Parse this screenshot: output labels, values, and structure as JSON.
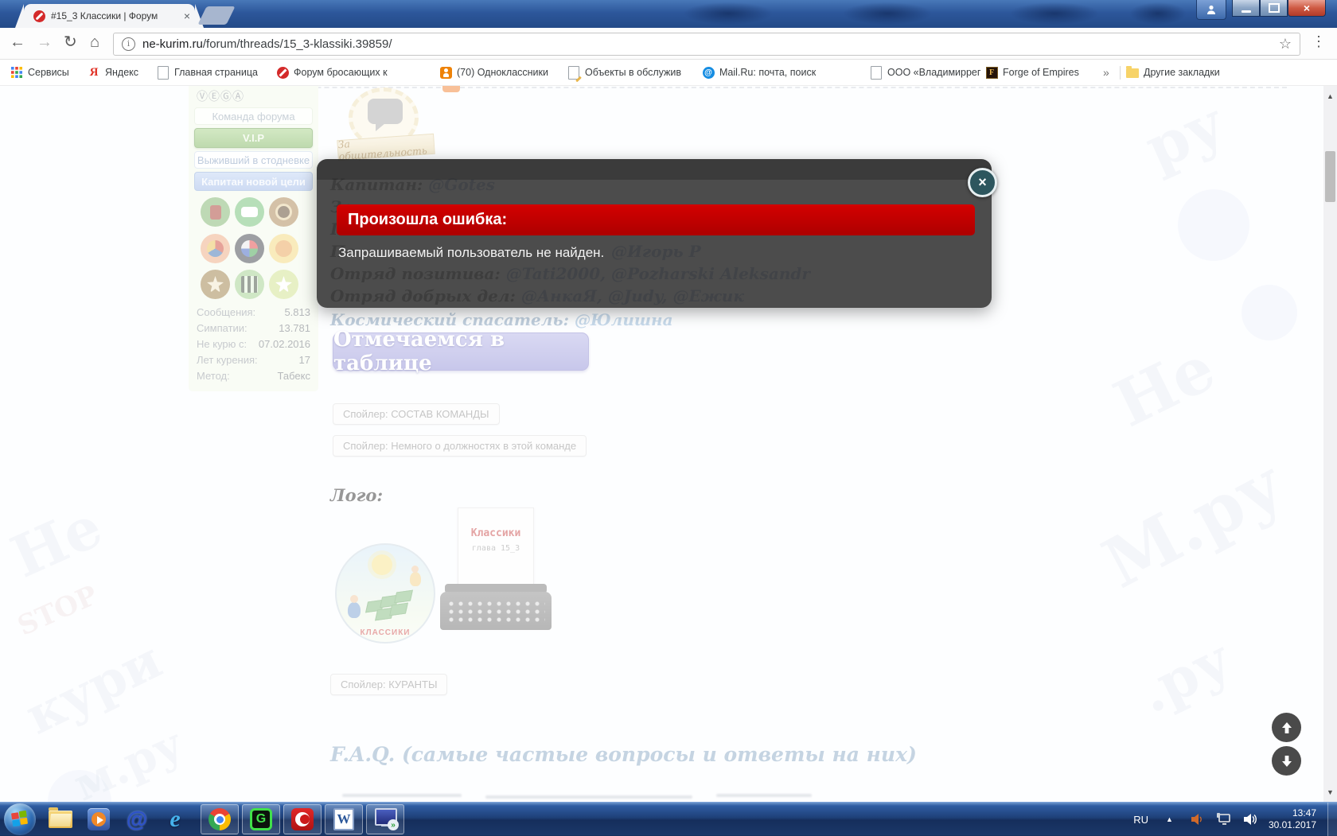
{
  "browser": {
    "tab_title": "#15_3 Классики | Форум",
    "url_host": "ne-kurim.ru",
    "url_path": "/forum/threads/15_3-klassiki.39859/",
    "overflow_chevron": "»",
    "other_bookmarks": "Другие закладки",
    "bookmarks": [
      {
        "label": "Сервисы"
      },
      {
        "label": "Яндекс"
      },
      {
        "label": "Главная страница"
      },
      {
        "label": "Форум бросающих к"
      },
      {
        "label": "(70) Одноклассники"
      },
      {
        "label": "Объекты в обслужив"
      },
      {
        "label": "Mail.Ru: почта, поиск"
      },
      {
        "label": "ООО «Владимиррег"
      },
      {
        "label": "Forge of Empires"
      }
    ]
  },
  "icons": {
    "yandex": "Я",
    "mail_at": "@",
    "forge_f": "F",
    "ie_e": "e",
    "word_w": "W",
    "g_app": "G",
    "back": "←",
    "forward": "→",
    "reload": "↻",
    "home": "⌂",
    "star": "☆",
    "menu_dots": "⋮",
    "info": "i",
    "tab_close": "×",
    "modal_close": "×",
    "window_close": "×",
    "tray_expand": "▲",
    "scrollbar_up": "▲",
    "scrollbar_down": "▼",
    "remote_arrows": "»"
  },
  "sidebar": {
    "vega": "ⓋⒺⒼⒶ",
    "ranks": [
      "Команда форума",
      "V.I.P",
      "Выживший в стодневке",
      "Капитан новой цели"
    ],
    "stats": [
      {
        "label": "Сообщения:",
        "value": "5.813"
      },
      {
        "label": "Симпатии:",
        "value": "13.781"
      },
      {
        "label": "Не курю с:",
        "value": "07.02.2016"
      },
      {
        "label": "Лет курения:",
        "value": "17"
      },
      {
        "label": "Метод:",
        "value": "Табекс"
      }
    ]
  },
  "post": {
    "award_ribbon": "За общительность",
    "line_captain_label": "Капитан:",
    "line_captain_link": "@Gotes",
    "line2_fragment": "За",
    "line3_fragment": "Пол",
    "line4_fragment": "По",
    "line4_link": "@Игорь Р",
    "line_positive_label": "Отряд позитива:",
    "line_positive_links": "@Tati2000, @Pozharski Aleksandr",
    "line_gooddeeds_label": "Отряд добрых дел:",
    "line_gooddeeds_links": "@АнкаЯ, @Judy, @Ежик",
    "line_rescuer_label": "Космический спасатель:",
    "line_rescuer_link": "@Юлишна",
    "checkin_button": "Отмечаемся в таблице",
    "spoiler_team": "Спойлер: СОСТАВ КОМАНДЫ",
    "spoiler_roles": "Спойлер: Немного о должностях в этой команде",
    "logo_label": "Лого:",
    "logo_circle_text": "КЛАССИКИ",
    "typewriter_title": "Классики",
    "typewriter_sub": "глава 15_3",
    "spoiler_chimes": "Спойлер: КУРАНТЫ",
    "faq_heading": "F.A.Q. (самые частые вопросы и ответы на них)"
  },
  "modal": {
    "title": "Произошла ошибка:",
    "message": "Запрашиваемый пользователь не найден."
  },
  "taskbar": {
    "lang": "RU",
    "time": "13:47",
    "date": "30.01.2017"
  },
  "colors": {
    "error_red": "#c20000",
    "accent_purple": "#9b99dd",
    "vip_green": "#86ba6e",
    "captain_blue": "#9cb6e6",
    "link_blue": "#5b7fae"
  }
}
